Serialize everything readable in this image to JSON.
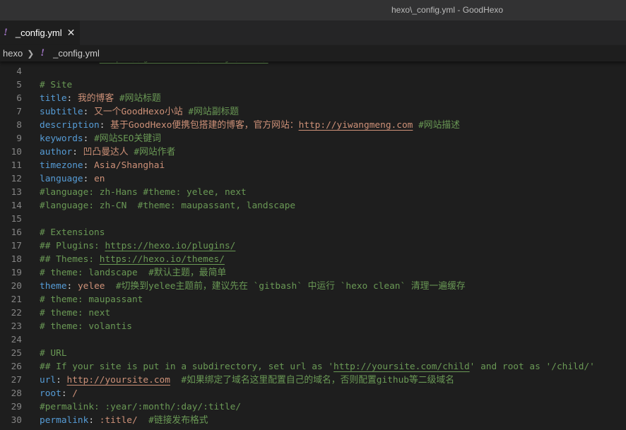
{
  "window": {
    "title": "hexo\\_config.yml - GoodHexo"
  },
  "tab": {
    "icon": "yaml-exclamation-icon",
    "label": "_config.yml",
    "close_icon": "close-icon"
  },
  "breadcrumb": {
    "folder": "hexo",
    "file": "_config.yml"
  },
  "colors": {
    "key": "#569cd6",
    "string": "#ce9178",
    "comment": "#6a9955",
    "background": "#1e1e1e",
    "yaml_icon": "#a074c4"
  },
  "editor": {
    "lines": [
      {
        "n": "3",
        "tokens": [
          {
            "t": "## Source: ",
            "y": "c"
          },
          {
            "t": "https://github.com/hexojs/hexo/",
            "y": "c u"
          }
        ]
      },
      {
        "n": "4",
        "tokens": []
      },
      {
        "n": "5",
        "tokens": [
          {
            "t": "# Site",
            "y": "c"
          }
        ]
      },
      {
        "n": "6",
        "tokens": [
          {
            "t": "title",
            "y": "k"
          },
          {
            "t": ": ",
            "y": "p"
          },
          {
            "t": "我的博客 ",
            "y": "s"
          },
          {
            "t": "#网站标题",
            "y": "c"
          }
        ]
      },
      {
        "n": "7",
        "tokens": [
          {
            "t": "subtitle",
            "y": "k"
          },
          {
            "t": ": ",
            "y": "p"
          },
          {
            "t": "又一个GoodHexo小站 ",
            "y": "s"
          },
          {
            "t": "#网站副标题",
            "y": "c"
          }
        ]
      },
      {
        "n": "8",
        "tokens": [
          {
            "t": "description",
            "y": "k"
          },
          {
            "t": ": ",
            "y": "p"
          },
          {
            "t": "基于GoodHexo便携包搭建的博客，官方网站：",
            "y": "s"
          },
          {
            "t": "http://yiwangmeng.com",
            "y": "s u"
          },
          {
            "t": " ",
            "y": "p"
          },
          {
            "t": "#网站描述",
            "y": "c"
          }
        ]
      },
      {
        "n": "9",
        "tokens": [
          {
            "t": "keywords",
            "y": "k"
          },
          {
            "t": ": ",
            "y": "p"
          },
          {
            "t": "#网站SEO关键词",
            "y": "c"
          }
        ]
      },
      {
        "n": "10",
        "tokens": [
          {
            "t": "author",
            "y": "k"
          },
          {
            "t": ": ",
            "y": "p"
          },
          {
            "t": "凹凸曼达人 ",
            "y": "s"
          },
          {
            "t": "#网站作者",
            "y": "c"
          }
        ]
      },
      {
        "n": "11",
        "tokens": [
          {
            "t": "timezone",
            "y": "k"
          },
          {
            "t": ": ",
            "y": "p"
          },
          {
            "t": "Asia/Shanghai",
            "y": "s"
          }
        ]
      },
      {
        "n": "12",
        "tokens": [
          {
            "t": "language",
            "y": "k"
          },
          {
            "t": ": ",
            "y": "p"
          },
          {
            "t": "en",
            "y": "s"
          }
        ]
      },
      {
        "n": "13",
        "tokens": [
          {
            "t": "#language: zh-Hans #theme: yelee, next",
            "y": "c"
          }
        ]
      },
      {
        "n": "14",
        "tokens": [
          {
            "t": "#language: zh-CN  #theme: maupassant, landscape",
            "y": "c"
          }
        ]
      },
      {
        "n": "15",
        "tokens": []
      },
      {
        "n": "16",
        "tokens": [
          {
            "t": "# Extensions",
            "y": "c"
          }
        ]
      },
      {
        "n": "17",
        "tokens": [
          {
            "t": "## Plugins: ",
            "y": "c"
          },
          {
            "t": "https://hexo.io/plugins/",
            "y": "c u"
          }
        ]
      },
      {
        "n": "18",
        "tokens": [
          {
            "t": "## Themes: ",
            "y": "c"
          },
          {
            "t": "https://hexo.io/themes/",
            "y": "c u"
          }
        ]
      },
      {
        "n": "19",
        "tokens": [
          {
            "t": "# theme: landscape  #默认主题，最简单",
            "y": "c"
          }
        ]
      },
      {
        "n": "20",
        "tokens": [
          {
            "t": "theme",
            "y": "k"
          },
          {
            "t": ": ",
            "y": "p"
          },
          {
            "t": "yelee",
            "y": "s"
          },
          {
            "t": "  #切换到yelee主题前，建议先在 `gitbash` 中运行 `hexo clean` 清理一遍缓存",
            "y": "c"
          }
        ]
      },
      {
        "n": "21",
        "tokens": [
          {
            "t": "# theme: maupassant",
            "y": "c"
          }
        ]
      },
      {
        "n": "22",
        "tokens": [
          {
            "t": "# theme: next",
            "y": "c"
          }
        ]
      },
      {
        "n": "23",
        "tokens": [
          {
            "t": "# theme: volantis",
            "y": "c"
          }
        ]
      },
      {
        "n": "24",
        "tokens": []
      },
      {
        "n": "25",
        "tokens": [
          {
            "t": "# URL",
            "y": "c"
          }
        ]
      },
      {
        "n": "26",
        "tokens": [
          {
            "t": "## If your site is put in a subdirectory, set url as '",
            "y": "c"
          },
          {
            "t": "http://yoursite.com/child",
            "y": "c u"
          },
          {
            "t": "' and root as '/child/'",
            "y": "c"
          }
        ]
      },
      {
        "n": "27",
        "tokens": [
          {
            "t": "url",
            "y": "k"
          },
          {
            "t": ": ",
            "y": "p"
          },
          {
            "t": "http://yoursite.com",
            "y": "s u"
          },
          {
            "t": "  #如果绑定了域名这里配置自己的域名，否则配置github等二级域名",
            "y": "c"
          }
        ]
      },
      {
        "n": "28",
        "tokens": [
          {
            "t": "root",
            "y": "k"
          },
          {
            "t": ": ",
            "y": "p"
          },
          {
            "t": "/",
            "y": "s"
          }
        ]
      },
      {
        "n": "29",
        "tokens": [
          {
            "t": "#permalink: :year/:month/:day/:title/",
            "y": "c"
          }
        ]
      },
      {
        "n": "30",
        "tokens": [
          {
            "t": "permalink",
            "y": "k"
          },
          {
            "t": ": ",
            "y": "p"
          },
          {
            "t": ":title/",
            "y": "s"
          },
          {
            "t": "  #链接发布格式",
            "y": "c"
          }
        ]
      }
    ]
  }
}
